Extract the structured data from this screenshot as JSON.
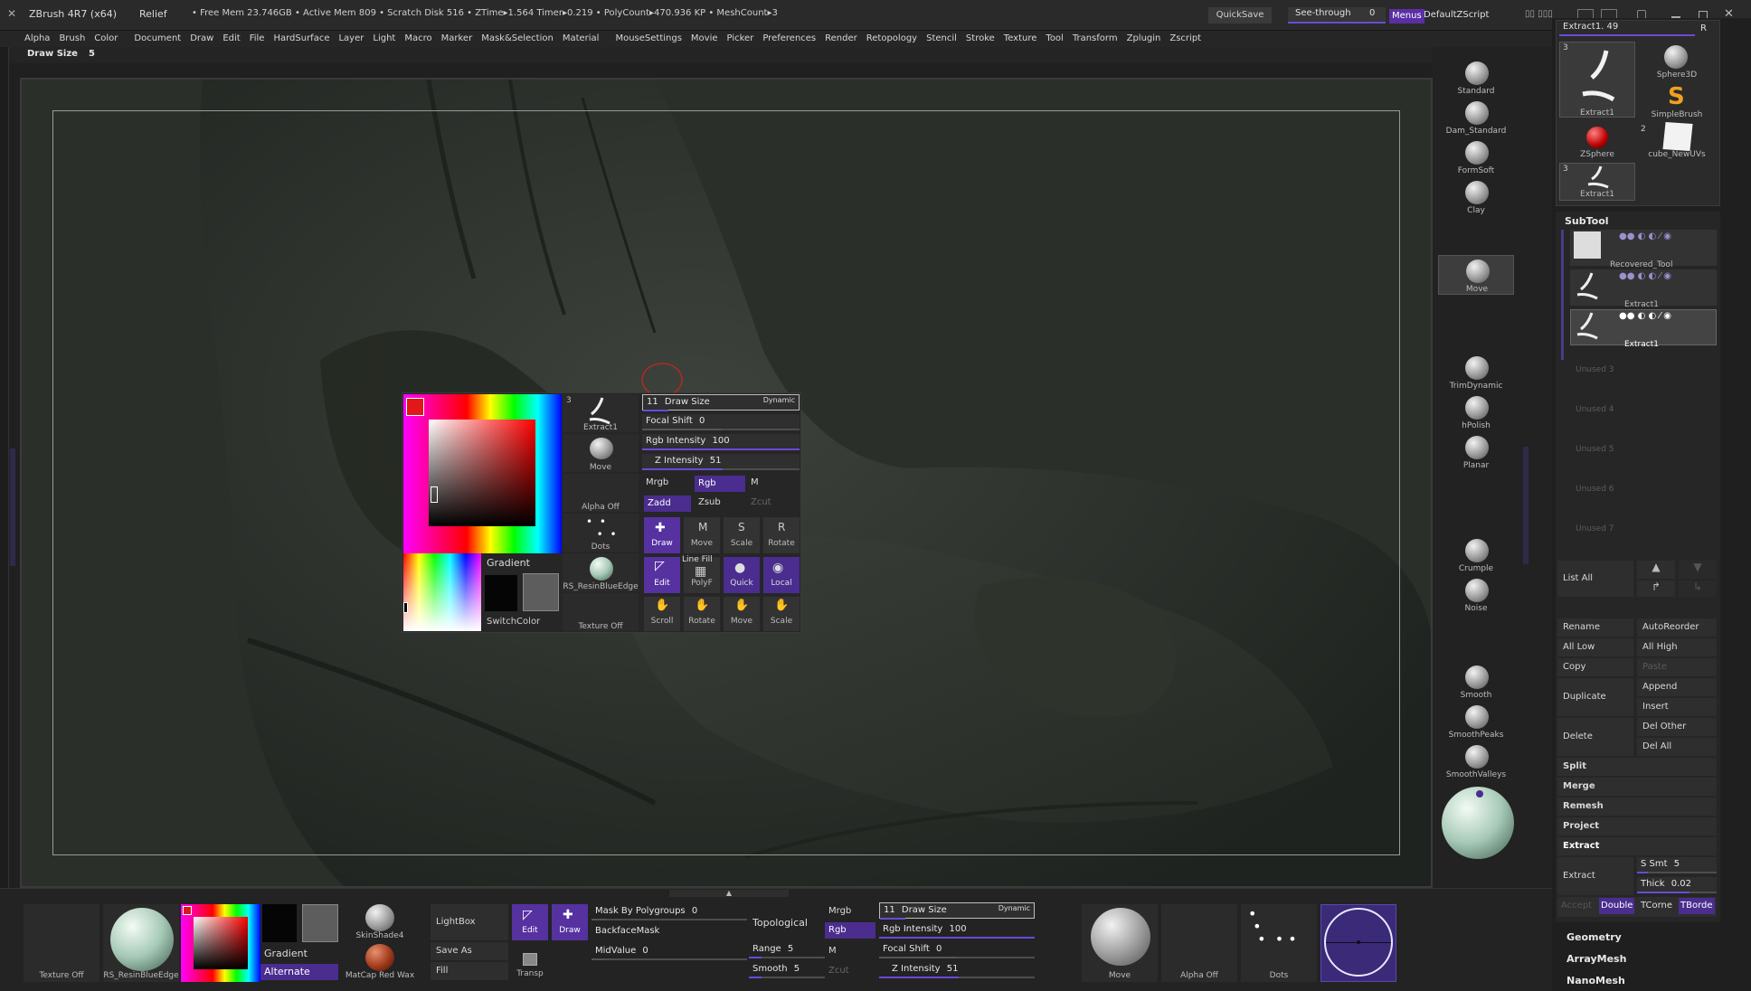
{
  "titlebar": {
    "app": "ZBrush 4R7 (x64)",
    "project": "Relief",
    "stats": "• Free Mem 23.746GB • Active Mem 809 • Scratch Disk 516 •  ZTime▸1.564 Timer▸0.219 • PolyCount▸470.936 KP • MeshCount▸3",
    "quicksave": "QuickSave",
    "seethrough": "See-through",
    "seethrough_value": "0",
    "menus": "Menus",
    "zscript": "DefaultZScript"
  },
  "menu": [
    "Alpha",
    "Brush",
    "Color",
    "Document",
    "Draw",
    "Edit",
    "File",
    "HardSurface",
    "Layer",
    "Light",
    "Macro",
    "Marker",
    "Mask&Selection",
    "Material",
    "MouseSettings",
    "Movie",
    "Picker",
    "Preferences",
    "Render",
    "Retopology",
    "Stencil",
    "Stroke",
    "Texture",
    "Tool",
    "Transform",
    "Zplugin",
    "Zscript"
  ],
  "drawsize_bar": {
    "label": "Draw Size",
    "value": "5"
  },
  "left_brushes": [
    {
      "label": "Standard"
    },
    {
      "label": "Dam_Standard"
    },
    {
      "label": "FormSoft"
    },
    {
      "label": "Clay"
    },
    {
      "label": "Move"
    },
    {
      "label": "TrimDynamic"
    },
    {
      "label": "hPolish"
    },
    {
      "label": "Planar"
    },
    {
      "label": "Crumple"
    },
    {
      "label": "Noise"
    },
    {
      "label": "Smooth"
    },
    {
      "label": "SmoothPeaks"
    },
    {
      "label": "SmoothValleys"
    }
  ],
  "tool_panel": {
    "header": "Extract1. 49",
    "r": "R",
    "items": [
      {
        "label": "Extract1",
        "count": "3"
      },
      {
        "label": "Sphere3D"
      },
      {
        "label": "SimpleBrush"
      },
      {
        "label": "ZSphere"
      },
      {
        "label": "cube_NewUVs",
        "count": "2"
      },
      {
        "label": "Extract1",
        "count": "3"
      }
    ]
  },
  "subtool": {
    "title": "SubTool",
    "items": [
      {
        "label": "Recovered_Tool"
      },
      {
        "label": "Extract1"
      },
      {
        "label": "Extract1"
      }
    ],
    "unused": [
      "Unused 3",
      "Unused 4",
      "Unused 5",
      "Unused 6",
      "Unused 7"
    ],
    "list_all": "List All",
    "rename": "Rename",
    "autoreorder": "AutoReorder",
    "all_low": "All Low",
    "all_high": "All High",
    "copy": "Copy",
    "paste": "Paste",
    "append": "Append",
    "duplicate": "Duplicate",
    "insert": "Insert",
    "del_other": "Del Other",
    "delete": "Delete",
    "del_all": "Del All",
    "split": "Split",
    "merge": "Merge",
    "remesh": "Remesh",
    "project": "Project",
    "extract_title": "Extract",
    "extract": "Extract",
    "smt_label": "S Smt",
    "smt_value": "5",
    "thick_label": "Thick",
    "thick_value": "0.02",
    "accept": "Accept",
    "double": "Double",
    "tcorne": "TCorne",
    "tborde": "TBorde",
    "geometry": "Geometry",
    "arraymesh": "ArrayMesh",
    "nanomesh": "NanoMesh"
  },
  "popup": {
    "gradient": "Gradient",
    "switchcolor": "SwitchColor",
    "tiles": [
      {
        "label": "Extract1",
        "count": "3"
      },
      {
        "label": "Move"
      },
      {
        "label": "Alpha  Off"
      },
      {
        "label": "Dots"
      },
      {
        "label": "RS_ResinBlueEdge"
      },
      {
        "label": "Texture  Off"
      }
    ],
    "draw_size_label": "Draw Size",
    "draw_size_value": "11",
    "dynamic": "Dynamic",
    "focal_label": "Focal Shift",
    "focal_value": "0",
    "rgb_int_label": "Rgb Intensity",
    "rgb_int_value": "100",
    "z_int_label": "Z Intensity",
    "z_int_value": "51",
    "mrgb": "Mrgb",
    "rgb": "Rgb",
    "m": "M",
    "zadd": "Zadd",
    "zsub": "Zsub",
    "zcut": "Zcut",
    "actions": [
      "Draw",
      "Move",
      "Scale",
      "Rotate",
      "Edit",
      "PolyF",
      "Quick",
      "Local",
      "Scroll",
      "Rotate",
      "Move",
      "Scale"
    ],
    "line_fill": "Line Fill"
  },
  "bottom": {
    "texture_off": "Texture  Off",
    "material": "RS_ResinBlueEdge",
    "gradient": "Gradient",
    "alternate": "Alternate",
    "skinshade": "SkinShade4",
    "matcap": "MatCap  Red  Wax",
    "lightbox": "LightBox",
    "save_as": "Save  As",
    "fill": "Fill",
    "transp": "Transp",
    "edit": "Edit",
    "draw": "Draw",
    "mask_by_polygroups_label": "Mask By Polygroups",
    "mask_by_polygroups_value": "0",
    "backfacemask": "BackfaceMask",
    "midvalue_label": "MidValue",
    "midvalue_value": "0",
    "topological": "Topological",
    "range_label": "Range",
    "range_value": "5",
    "smooth_label": "Smooth",
    "smooth_value": "5",
    "mrgb": "Mrgb",
    "rgb": "Rgb",
    "m": "M",
    "zcut": "Zcut",
    "draw_size_label": "Draw Size",
    "draw_size_value": "11",
    "dynamic": "Dynamic",
    "rgb_int_label": "Rgb Intensity",
    "rgb_int_value": "100",
    "focal_label": "Focal Shift",
    "focal_value": "0",
    "z_int_label": "Z Intensity",
    "z_int_value": "51",
    "move": "Move",
    "alpha_off": "Alpha  Off",
    "dots": "Dots"
  }
}
